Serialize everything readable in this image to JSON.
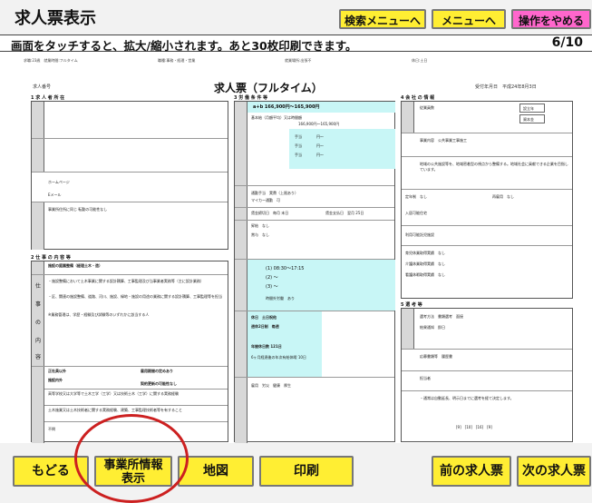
{
  "header": {
    "title": "求人票表示",
    "buttons": {
      "search_menu": "検索メニューへ",
      "menu": "メニューへ",
      "quit": "操作をやめる"
    },
    "notice": "画面をタッチすると、拡大/縮小されます。あと30枚印刷できます。",
    "page": "6/10"
  },
  "document": {
    "head_items": [
      "求職:23歳　就業時間:フルタイム",
      "職種:事務・経理・営業",
      "就業場所:出張不",
      "休日:土日"
    ],
    "number_label": "求人番号",
    "title": "求人票（フルタイム）",
    "received": "受付年月日　平成24年8月3日",
    "sections": {
      "s1": "1 求 人 者 所 在",
      "s2": "2 仕 事 の 内 容 等",
      "s3": "3 労 働 条 件 等",
      "s4": "4 会 社 の 情 報",
      "s5": "5 選 考 等"
    },
    "company": {
      "homepage": "ホームページ",
      "email": "Eメール",
      "transfer": "事業所住所に同じ 転勤の可能性なし"
    },
    "job": {
      "job_label": "職種",
      "job_value": "施設の庭園整備（経理土木・造）",
      "vertical": [
        "仕",
        "事",
        "の",
        "内",
        "容"
      ],
      "desc1": "・施設整備において土木事業に関する設計積算、工事監理及び当事業者実務等（主に設計業務）",
      "desc2": "・区、関連の施設整備、道路、河川、施設、緑地・施設の用途の業務に関する設計積算、工事監理等を担当",
      "desc3": "※業務管理は、学歴・経験及び試験等のいずれかに該当する人",
      "employment": "正社員以外",
      "period": "雇用期間の定めあり",
      "dispatch": "施設内外",
      "renew": "契約更新の可能性なし",
      "education": "学歴",
      "experience": "必要な経験等",
      "exp_text": "高等学校又は大学等で土木工学（工学）又は技術士木（工学）に関する実務経験",
      "license": "必要な免許資格",
      "license_text": "土木施業又は土木技術者に関する実務経験、建築、工事監理技術者等を有すること",
      "age": "年齢",
      "age_value": "不問"
    },
    "wage": {
      "label": "a+b 166,900円〜165,900円",
      "base": "基本給（月額平均）又は時間額",
      "base_value": "166,900円〜165,900円",
      "allowances": [
        "手当",
        "円〜",
        "円"
      ],
      "commute": "通勤手当　実費（上限あり）",
      "commute_max": "マイカー通勤　可",
      "salary_day": "賃金締切日　毎月 末日",
      "pay_day": "賃金支払日　翌月 25日",
      "raise": "昇給　なし",
      "bonus": "賞与　なし",
      "hours": "(1) 08:30〜17:15",
      "hours2": "(2) 〜",
      "hours3": "(3) 〜",
      "overtime": "時間外労働　あり",
      "holiday": "休日　土日祝他",
      "weekly": "週休2日制　毎週",
      "holidays_year": "年間休日数 121日",
      "paid_leave": "6ヶ月経過後の年次有給休暇 10日",
      "insurance": "雇用　労災　健康　厚生"
    },
    "company_info": {
      "employees": "従業員数",
      "founding": "設立年",
      "capital": "資本金",
      "business": "事業内容　公共事業工事施工",
      "feature": "会社の特長",
      "feature_text": "地域の公共施設等を、地域密着型の視点から整備する。地域社会に貢献できる企業を目指しています。",
      "retirement": "定年制　なし",
      "rehire": "再雇用　なし",
      "welfare": "入居可能住宅",
      "daycare": "利用可能託児施設",
      "dispatch_work": "育児休業取得実績　なし",
      "care": "介護休業取得実績　なし",
      "nursing": "看護休暇取得実績　なし"
    },
    "selection": {
      "method": "選考方法　書類選考　面接",
      "result": "結果通知　即日",
      "docs": "応募書類等　履歴書",
      "contact": "担当者",
      "notes": "備考",
      "notes_text": "・通常は自動延長、明示日までに選考を経て決定します。",
      "footer": "[9]　[10]　[16]　[9]"
    }
  },
  "bottom": {
    "back": "もどる",
    "office_info_line1": "事業所情報",
    "office_info_line2": "表示",
    "map": "地図",
    "print": "印刷",
    "prev": "前の求人票",
    "next": "次の求人票"
  },
  "colors": {
    "button": "#ffee33",
    "quit_button": "#ff66cc",
    "highlight": "#c8f6f6",
    "circle": "#cc2020"
  }
}
